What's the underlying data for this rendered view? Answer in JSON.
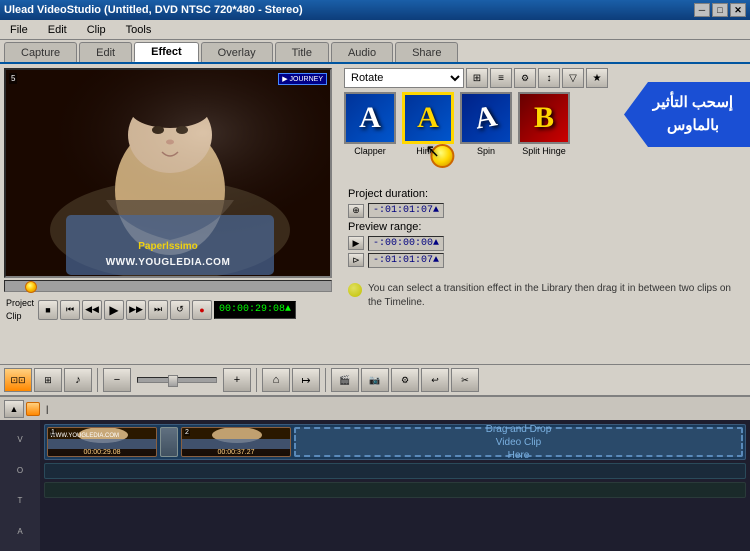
{
  "window": {
    "title": "Ulead VideoStudio (Untitled, DVD NTSC 720*480 - Stereo)",
    "close_btn": "✕",
    "max_btn": "□",
    "min_btn": "─"
  },
  "menu": {
    "items": [
      "File",
      "Edit",
      "Clip",
      "Tools",
      "Capture",
      "Edit",
      "Effect",
      "Overlay",
      "Title",
      "Audio",
      "Share"
    ]
  },
  "tabs": {
    "items": [
      "Capture",
      "Edit",
      "Effect",
      "Overlay",
      "Title",
      "Audio",
      "Share"
    ],
    "active": "Effect"
  },
  "effects": {
    "dropdown_value": "Rotate",
    "items": [
      {
        "id": "clapper",
        "letter": "A",
        "label": "Clapper",
        "style": "clapper"
      },
      {
        "id": "hinge",
        "letter": "A",
        "label": "Hinge",
        "style": "hinge",
        "selected": true
      },
      {
        "id": "spin",
        "letter": "A",
        "label": "Spin",
        "style": "spin"
      },
      {
        "id": "splithinge",
        "letter": "B",
        "label": "Split Hinge",
        "style": "splithinge"
      }
    ]
  },
  "arabic_tooltip": "إسحب التأثير\nبالماوس",
  "project": {
    "duration_label": "Project duration:",
    "duration_value": "-:01:01:07▲",
    "preview_range_label": "Preview range:",
    "preview_start": "-:00:00:00▲",
    "preview_end": "-:01:01:07▲",
    "hint": "You can select a transition effect in the Library then drag it in between two clips on the Timeline."
  },
  "playback": {
    "time": "00:00:29:08▲",
    "project_label": "Project",
    "clip_label": "Clip"
  },
  "timeline": {
    "clip1_time": "00:00:29.08",
    "clip1_num": "1",
    "clip2_time": "00:00:37.27",
    "clip2_num": "2",
    "drop_zone_text": "Drag and Drop\nVideo Clip\nHere"
  },
  "controls": {
    "play": "▶",
    "stop": "■",
    "prev": "⏮",
    "next": "⏭",
    "rewind": "◀◀",
    "forward": "▶▶",
    "loop": "↺",
    "record": "⏺"
  },
  "toolbar_icons": {
    "storyboard": "≡",
    "timeline": "⊞",
    "audio": "♪",
    "zoom_in": "+",
    "zoom_out": "─",
    "home": "⌂",
    "end": "↦"
  }
}
